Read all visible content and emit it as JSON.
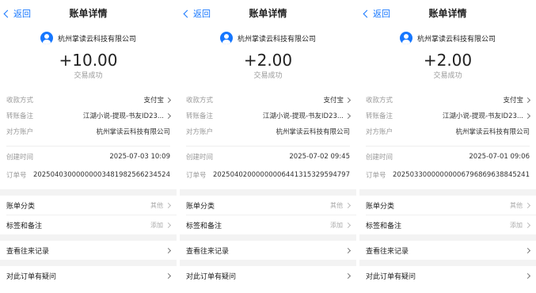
{
  "panels": [
    {
      "back_label": "返回",
      "title": "账单详情",
      "merchant": "杭州掌读云科技有限公司",
      "amount": "+10.00",
      "status": "交易成功",
      "payment_method_label": "收款方式",
      "payment_method_value": "支付宝",
      "remark_label": "转账备注",
      "remark_value": "江湖小说-提现-书友ID23...",
      "account_label": "对方账户",
      "account_value": "杭州掌读云科技有限公司",
      "created_label": "创建时间",
      "created_value": "2025-07-03 10:09",
      "order_label": "订单号",
      "order_value": "20250403000000003481982566234524",
      "category_label": "账单分类",
      "category_value": "其他",
      "tag_label": "标签和备注",
      "tag_value": "添加",
      "history_label": "查看往来记录",
      "question_label": "对此订单有疑问"
    },
    {
      "back_label": "返回",
      "title": "账单详情",
      "merchant": "杭州掌读云科技有限公司",
      "amount": "+2.00",
      "status": "交易成功",
      "payment_method_label": "收款方式",
      "payment_method_value": "支付宝",
      "remark_label": "转账备注",
      "remark_value": "江湖小说-提现-书友ID23...",
      "account_label": "对方账户",
      "account_value": "杭州掌读云科技有限公司",
      "created_label": "创建时间",
      "created_value": "2025-07-02 09:45",
      "order_label": "订单号",
      "order_value": "20250402000000006441315329594797",
      "category_label": "账单分类",
      "category_value": "其他",
      "tag_label": "标签和备注",
      "tag_value": "添加",
      "history_label": "查看往来记录",
      "question_label": "对此订单有疑问"
    },
    {
      "back_label": "返回",
      "title": "账单详情",
      "merchant": "杭州掌读云科技有限公司",
      "amount": "+2.00",
      "status": "交易成功",
      "payment_method_label": "收款方式",
      "payment_method_value": "支付宝",
      "remark_label": "转账备注",
      "remark_value": "江湖小说-提现-书友ID23...",
      "account_label": "对方账户",
      "account_value": "杭州掌读云科技有限公司",
      "created_label": "创建时间",
      "created_value": "2025-07-01 09:06",
      "order_label": "订单号",
      "order_value": "20250330000000006796869638845241",
      "category_label": "账单分类",
      "category_value": "其他",
      "tag_label": "标签和备注",
      "tag_value": "添加",
      "history_label": "查看往来记录",
      "question_label": "对此订单有疑问"
    }
  ],
  "colors": {
    "accent": "#1677ff",
    "muted": "#999999",
    "separator": "#f3f3f3"
  },
  "icons": {
    "back": "chevron-left-icon",
    "avatar": "merchant-avatar-icon",
    "row_arrow": "chevron-right-icon"
  }
}
